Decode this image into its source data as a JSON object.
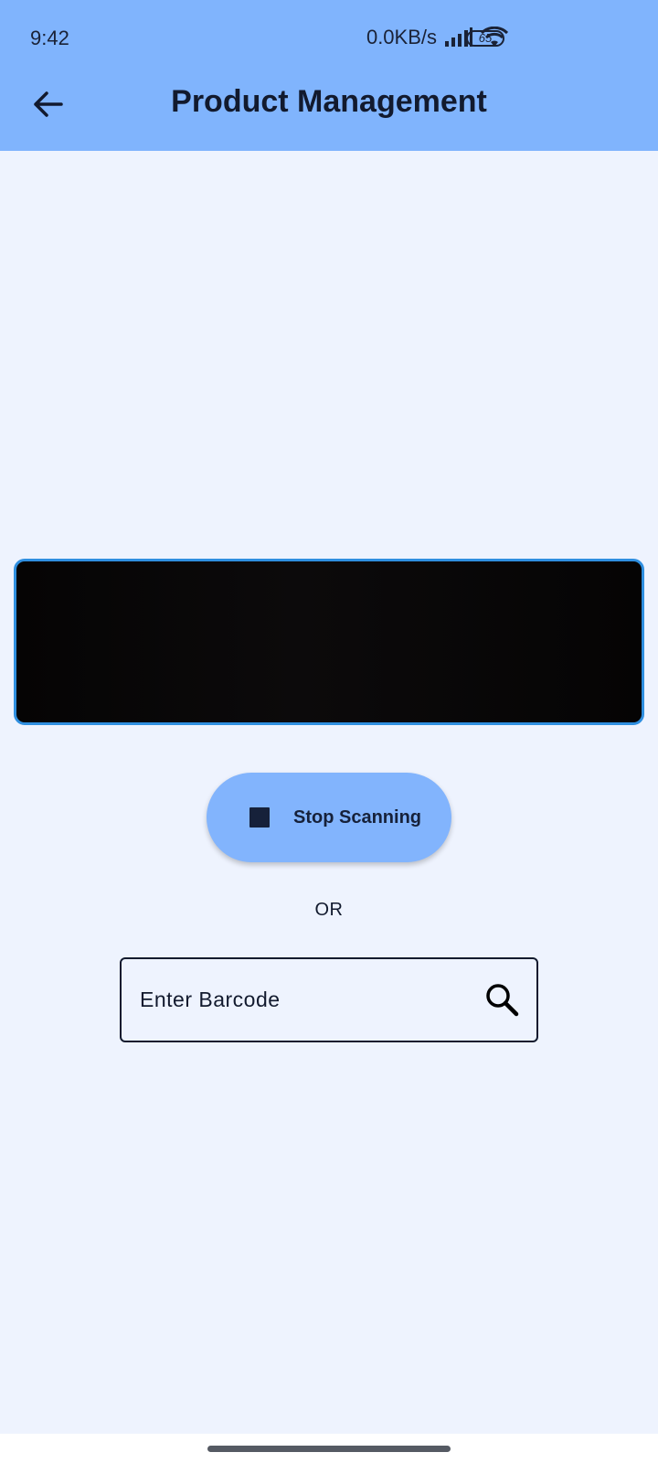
{
  "status_bar": {
    "time": "9:42",
    "net_speed": "0.0KB/s",
    "battery_level": "65",
    "icons": [
      "signal-icon",
      "wifi-icon",
      "battery-icon"
    ]
  },
  "app_bar": {
    "title": "Product Management",
    "back_icon": "arrow-back-icon"
  },
  "scanner": {
    "border_color": "#2f8fe0"
  },
  "scan_button": {
    "label": "Stop Scanning",
    "icon": "stop-icon"
  },
  "divider_text": "OR",
  "barcode_input": {
    "placeholder": "Enter Barcode",
    "value": "",
    "icon": "search-icon"
  },
  "colors": {
    "app_bar": "#80b4fd",
    "background": "#eef3fe",
    "text": "#121a2e",
    "button": "#82b4fd"
  }
}
